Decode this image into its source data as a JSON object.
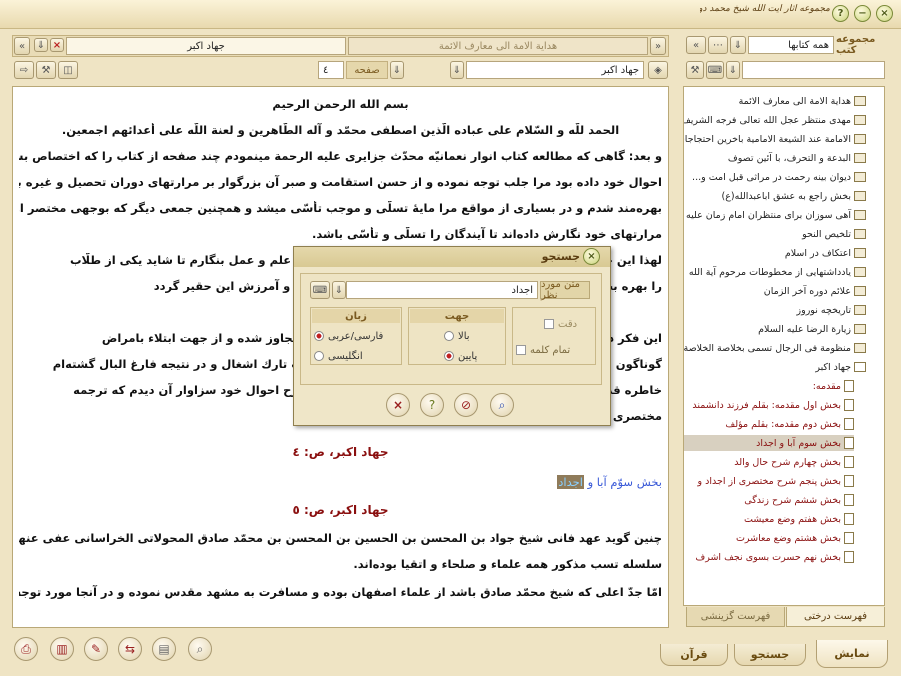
{
  "app": {
    "logo_text": "مجموعه آثار آیت الله شیخ محمد دولت آبادی"
  },
  "reader": {
    "tab_title": "هداية الامة الى معارف الائمة",
    "current_book": "جهاد اكبر",
    "nav_book": "جهاد اكبر",
    "page_label": "صفحه",
    "page_value": "٤"
  },
  "document": {
    "lines": [
      "بسم الله الرحمن الرحيم",
      "الحمد للّه و السّلام على عباده الّذين اصطفى محمّد و آله الطّاهرين و لعنة اللّه على أعدائهم اجمعين.",
      "و بعد: گاهى كه مطالعه كتاب انوار نعمانيّه محدّث جزايرى عليه الرحمة مينمودم چند صفحه از كتاب را كه اختصاص بشرح",
      "احوال خود داده بود مرا جلب توجه نموده و از حسن استقامت و صبر آن بزرگوار بر مرارتهاى دوران تحصيل و غيره بسيار",
      "بهره‌مند شدم و در بسيارى از مواقع مرا مايهٔ تسلّى و موجب تأسّى ميشد و همچنين جمعى ديگر كه بوجهى مختصر از",
      "مرارتهاى خود نگارش داده‌اند تا آيندگان را تسلّى و تأسّى باشد.",
      "لهذا اين حقير نيز بر آن شدم كه شمّه‌اى از احوال خود را در سبيل علم و عمل بنگارم تا شايد يكى از طلّاب",
      "را بهره بخشد و مرا بدعاى خير ياد نمايند و شايد همين وسيله عفو و آمرزش اين حقير گردد",
      "",
      "اين فكر در سال‌ها بخاطرم بود و اكنون كه سنين عمرم از پنجاه متجاوز شده و از جهت ابتلاء بامراض",
      "گوناگون و ضعف مزاج و مشاغل متعدد و عدم فرصت و قدرت علّت تارك اشغال و در نتيجه فارغ البال گشته‌ام",
      "خاطره قديمى بخاطرم آمد كه جا دارد شمّه‌اى از سوانح قبل از شرح احوال خود سزاوار آن ديدم كه ترجمه",
      "مختصرى از پدران خود نيز بنويسم."
    ],
    "ref1": "جهاد اكبر، ص: ٤",
    "section_prefix": "بخش سوّم آبا و",
    "section_highlight": "اجداد",
    "ref2": "جهاد اكبر، ص: ٥",
    "lines2": [
      "چنين گويد عهد فانى شيخ جواد بن المحسن بن الحسين بن المحسن بن محمّد صادق المحولاتى الخراسانى عفى عنهم جميعا غ غ اين",
      "سلسله تسب مذكور همه علماء و صلحاء و اتقيا بوده‌اند.",
      "امّا جدّ اعلى كه شيخ محمّد صادق باشد از علماء اصفهان بوده و مسافرت به مشهد مقدس نموده و در آنجا مورد توجه اهالى و"
    ]
  },
  "sidebar": {
    "header_label": "مجموعه كتب",
    "filter_value": "همه كتابها",
    "search_value": "",
    "books": [
      "هداية الامة الى معارف الائمة",
      "مهدى منتظر عجل الله تعالى فرجه الشريف",
      "الامامة عند الشيعة الامامية باخرين احتجاجات",
      "البدعة و التحرف، با آئين تصوف",
      "ديوان بينه رحمت در مراثى قبل امت و...",
      "بخش راجع به عشق اباعبدالله(ع)",
      "آهى سوزان براى منتظران امام زمان عليه السلام",
      "تلخيص النحو",
      "اعتكاف در اسلام",
      "يادداشتهايى از مخطوطات مرحوم آية الله",
      "علائم دوره آخر الزمان",
      "تاريخچه نوروز",
      "زيارة الرضا عليه السلام",
      "منظومة فى الرجال تسمى بخلاصة الخلاصة",
      "جهاد اكبر"
    ],
    "sections": [
      "مقدمه:",
      "بخش اول مقدمه: بقلم فرزند دانشمند",
      "بخش دوم مقدمه: بقلم مؤلف",
      "بخش سوم آبا و اجداد",
      "بخش چهارم شرح حال والد",
      "بخش پنجم شرح مختصرى از اجداد و",
      "بخش ششم شرح زندگى",
      "بخش هفتم وضع معيشت",
      "بخش هشتم وضع معاشرت",
      "بخش نهم حسرت بسوى نجف اشرف"
    ],
    "tab_tree": "فهرست درختى",
    "tab_search": "فهرست گزينشى"
  },
  "bottom_tabs": [
    "نمايش",
    "جستجو",
    "قرآن"
  ],
  "dialog": {
    "title": "جستجو",
    "text_label": "متن مورد نظر",
    "text_value": "اجداد",
    "direction_title": "جهت",
    "direction_up": "بالا",
    "direction_down": "پايين",
    "language_title": "زبان",
    "language_fa": "فارسى/عربى",
    "language_en": "انگليسى",
    "exact_label": "دقت",
    "whole_word_label": "تمام كلمه"
  }
}
